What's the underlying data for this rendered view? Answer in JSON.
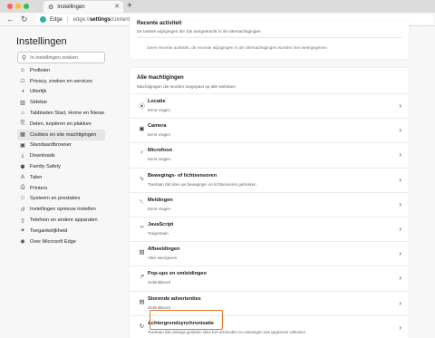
{
  "browser": {
    "tab_title": "Instellingen",
    "tab_icon": "gear-icon",
    "address": {
      "brand": "Edge",
      "separator": "|",
      "scheme": "edge://",
      "path_strong": "settings",
      "path_rest": "/content"
    }
  },
  "sidebar": {
    "title": "Instellingen",
    "search_placeholder": "In instellingen zoeken",
    "items": [
      {
        "label": "Profielen",
        "icon": "profile-icon",
        "glyph": "☺"
      },
      {
        "label": "Privacy, zoeken en services",
        "icon": "lock-icon",
        "glyph": "☖"
      },
      {
        "label": "Uiterlijk",
        "icon": "appearance-icon",
        "glyph": "◑"
      },
      {
        "label": "Sidebar",
        "icon": "sidebar-icon",
        "glyph": "▥"
      },
      {
        "label": "Tabbladen Start, Home en Nieuw",
        "icon": "home-icon",
        "glyph": "⌂"
      },
      {
        "label": "Delen, kopiëren en plakken",
        "icon": "share-icon",
        "glyph": "⎘"
      },
      {
        "label": "Cookies en site machtigingen",
        "icon": "cookie-icon",
        "glyph": "▦"
      },
      {
        "label": "Standaardbrowser",
        "icon": "browser-icon",
        "glyph": "▣"
      },
      {
        "label": "Downloads",
        "icon": "download-icon",
        "glyph": "⤓"
      },
      {
        "label": "Family Safety",
        "icon": "family-icon",
        "glyph": "⚉"
      },
      {
        "label": "Talen",
        "icon": "language-icon",
        "glyph": "A"
      },
      {
        "label": "Printers",
        "icon": "printer-icon",
        "glyph": "⎙"
      },
      {
        "label": "Systeem en prestaties",
        "icon": "system-icon",
        "glyph": "□"
      },
      {
        "label": "Instellingen opnieuw instellen",
        "icon": "reset-icon",
        "glyph": "↺"
      },
      {
        "label": "Telefoon en andere apparaten",
        "icon": "phone-icon",
        "glyph": "▯"
      },
      {
        "label": "Toegankelijkheid",
        "icon": "accessibility-icon",
        "glyph": "✦"
      },
      {
        "label": "Over Microsoft Edge",
        "icon": "edge-logo-icon",
        "glyph": "◉"
      }
    ]
  },
  "recent_activity": {
    "title": "Recente activiteit",
    "subtitle": "De laatste wijzigingen die zijn aangebracht in de sitemachtigingen",
    "empty": "Geen recente activiteit, de recente wijzigingen in de sitemachtigingen worden hier weergegeven"
  },
  "permissions": {
    "title": "Alle machtigingen",
    "subtitle": "Machtigingen die worden toegepast op alle websites",
    "items": [
      {
        "name": "Locatie",
        "state": "Eerst vragen",
        "icon": "location-icon",
        "glyph": "⦿"
      },
      {
        "name": "Camera",
        "state": "Eerst vragen",
        "icon": "camera-icon",
        "glyph": "▣"
      },
      {
        "name": "Microfoon",
        "state": "Eerst vragen",
        "icon": "microphone-icon",
        "glyph": "♂"
      },
      {
        "name": "Bewegings- of lichtsensoren",
        "state": "Toestaan dat sites uw bewegings- en lichtsensoren gebruiken",
        "icon": "sensor-icon",
        "glyph": "∿"
      },
      {
        "name": "Meldingen",
        "state": "Eerst vragen",
        "icon": "bell-icon",
        "glyph": "␇"
      },
      {
        "name": "JavaScript",
        "state": "Toegestaan",
        "icon": "javascript-icon",
        "glyph": "‹›"
      },
      {
        "name": "Afbeeldingen",
        "state": "Alles weergeven",
        "icon": "image-icon",
        "glyph": "▨"
      },
      {
        "name": "Pop-ups en omleidingen",
        "state": "Geblokkeerd",
        "icon": "popup-icon",
        "glyph": "↗"
      },
      {
        "name": "Storende advertenties",
        "state": "Geblokkeerd",
        "icon": "ads-icon",
        "glyph": "▤"
      },
      {
        "name": "Achtergrondsynchronisatie",
        "state": "Toestaan dat onlangs gesloten sites het verzenden en ontvangen van gegevens voltooien",
        "icon": "sync-icon",
        "glyph": "↻"
      }
    ]
  },
  "colors": {
    "highlight": "#e8772e",
    "active_bg": "#e6e6e6"
  }
}
